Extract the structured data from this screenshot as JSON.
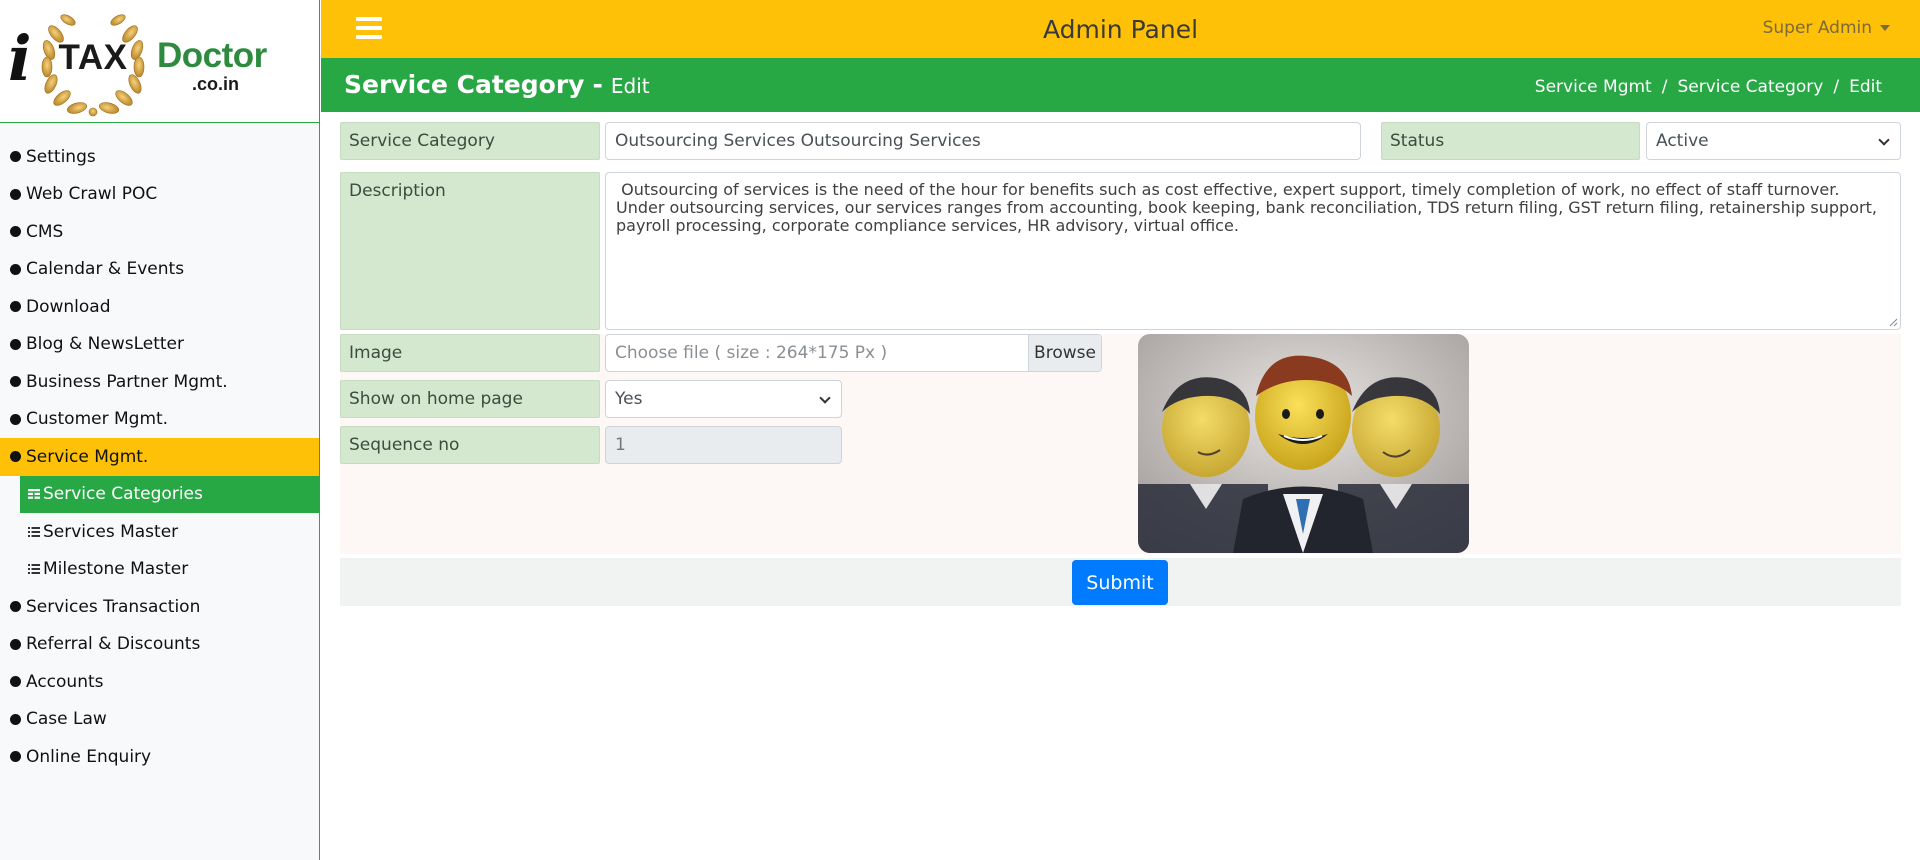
{
  "brand": {
    "logo_i": "i",
    "logo_tax": "TAX",
    "logo_doctor": "Doctor",
    "logo_domain": ".co.in"
  },
  "topbar": {
    "title": "Admin Panel",
    "user": "Super Admin",
    "bar_color": "#ffc107"
  },
  "sidebar": {
    "items": [
      {
        "label": "Settings"
      },
      {
        "label": "Web Crawl POC"
      },
      {
        "label": "CMS"
      },
      {
        "label": "Calendar & Events"
      },
      {
        "label": "Download"
      },
      {
        "label": "Blog & NewsLetter"
      },
      {
        "label": "Business Partner Mgmt."
      },
      {
        "label": "Customer Mgmt."
      },
      {
        "label": "Service Mgmt.",
        "active": true,
        "children": [
          {
            "label": "Service Categories",
            "active": true,
            "icon": "table-icon"
          },
          {
            "label": "Services Master",
            "icon": "list-icon"
          },
          {
            "label": "Milestone Master",
            "icon": "list-icon"
          }
        ]
      },
      {
        "label": "Services Transaction"
      },
      {
        "label": "Referral & Discounts"
      },
      {
        "label": "Accounts"
      },
      {
        "label": "Case Law"
      },
      {
        "label": "Online Enquiry"
      }
    ]
  },
  "page": {
    "title": "Service Category",
    "separator": "-",
    "subtitle": "Edit",
    "header_color": "#28a745",
    "breadcrumb": [
      "Service Mgmt",
      "Service Category",
      "Edit"
    ],
    "breadcrumb_sep": "/"
  },
  "form": {
    "category_label": "Service Category",
    "category_value": "Outsourcing Services Outsourcing Services",
    "status_label": "Status",
    "status_value": "Active",
    "description_label": "Description",
    "description_value": " Outsourcing of services is the need of the hour for benefits such as cost effective, expert support, timely completion of work, no effect of staff turnover. Under outsourcing services, our services ranges from accounting, book keeping, bank reconciliation, TDS return filing, GST return filing, retainership support, payroll processing, corporate compliance services, HR advisory, virtual office.",
    "image_label": "Image",
    "file_placeholder": "Choose file ( size : 264*175 Px )",
    "browse_label": "Browse",
    "home_label": "Show on home page",
    "home_value": "Yes",
    "sequence_label": "Sequence no",
    "sequence_value": "1",
    "submit_label": "Submit",
    "submit_color": "#007bff"
  }
}
